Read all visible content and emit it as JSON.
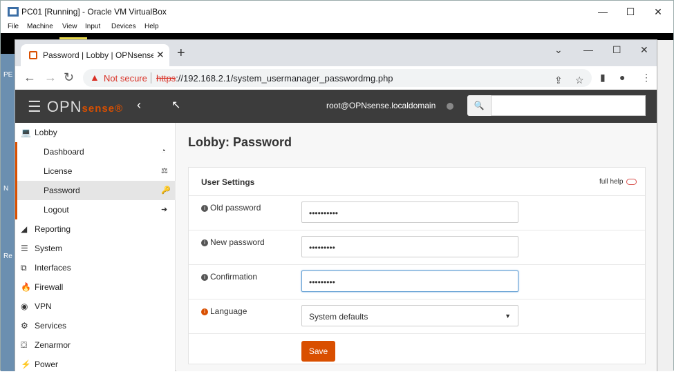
{
  "vbox": {
    "title": "PC01 [Running] - Oracle VM VirtualBox",
    "menu": [
      "File",
      "Machine",
      "View",
      "Input",
      "Devices",
      "Help"
    ],
    "min": "—",
    "max": "☐",
    "close": "✕",
    "side_text": "Re",
    "side_text2": "PE",
    "side_text3": "N"
  },
  "browser": {
    "tab_title": "Password | Lobby | OPNsense.loc",
    "tab_close": "✕",
    "new_tab": "+",
    "chev": "⌄",
    "min": "—",
    "max": "☐",
    "close": "✕",
    "not_secure": "Not secure",
    "url_scheme": "https",
    "url_rest": "://192.168.2.1/system_usermanager_passwordmg.php"
  },
  "topbar": {
    "logo": "OPN",
    "logo2": "sense",
    "logo3": "®",
    "collapse": "‹",
    "user": "root@OPNsense.localdomain",
    "search_icon": "🔍"
  },
  "sidebar": {
    "items": [
      {
        "label": "Lobby",
        "icon": "laptop-icon",
        "glyph": "💻"
      },
      {
        "label": "Dashboard",
        "icon": "dashboard-icon",
        "glyph": "◔"
      },
      {
        "label": "License",
        "icon": "balance-scale-icon",
        "glyph": "⚖"
      },
      {
        "label": "Password",
        "icon": "key-icon",
        "glyph": "🔑"
      },
      {
        "label": "Logout",
        "icon": "sign-out-icon",
        "glyph": "➜"
      },
      {
        "label": "Reporting",
        "icon": "area-chart-icon",
        "glyph": "◢"
      },
      {
        "label": "System",
        "icon": "server-icon",
        "glyph": "☰"
      },
      {
        "label": "Interfaces",
        "icon": "sitemap-icon",
        "glyph": "⧉"
      },
      {
        "label": "Firewall",
        "icon": "fire-icon",
        "glyph": "🔥"
      },
      {
        "label": "VPN",
        "icon": "globe-icon",
        "glyph": "◉"
      },
      {
        "label": "Services",
        "icon": "cog-icon",
        "glyph": "⚙"
      },
      {
        "label": "Zenarmor",
        "icon": "binoculars-icon",
        "glyph": "⛋"
      },
      {
        "label": "Power",
        "icon": "plug-icon",
        "glyph": "⚡"
      }
    ]
  },
  "main": {
    "title": "Lobby: Password",
    "panel_title": "User Settings",
    "full_help": "full help",
    "fields": [
      {
        "label": "Old password",
        "value": "••••••••••"
      },
      {
        "label": "New password",
        "value": "•••••••••"
      },
      {
        "label": "Confirmation",
        "value": "•••••••••"
      },
      {
        "label": "Language",
        "value": "System defaults"
      }
    ],
    "save": "Save"
  },
  "colors": {
    "accent": "#d94f00",
    "topbar": "#3c3c3c"
  }
}
